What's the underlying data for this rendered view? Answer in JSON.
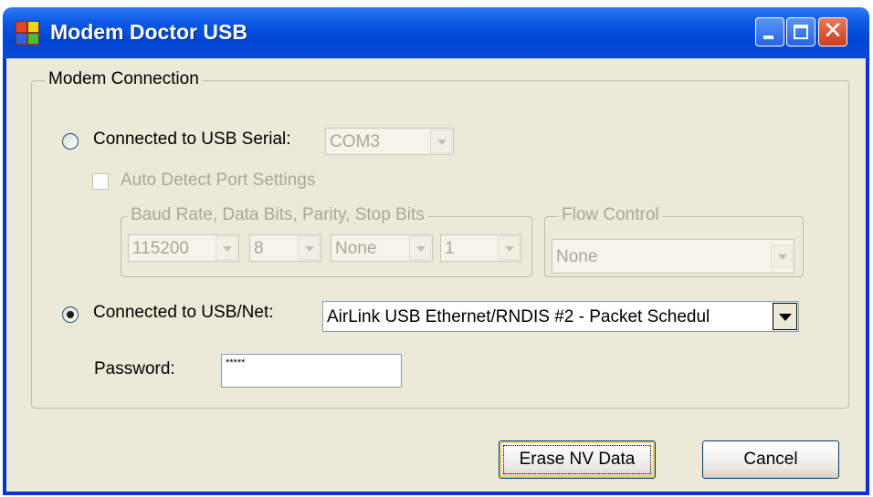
{
  "window": {
    "title": "Modem Doctor USB"
  },
  "modem_connection": {
    "group_label": "Modem Connection",
    "usb_serial": {
      "label": "Connected to USB Serial:",
      "selected": false,
      "port": "COM3",
      "auto_detect_label": "Auto Detect Port Settings",
      "auto_detect_checked": false,
      "port_settings_label": "Baud Rate, Data Bits, Parity, Stop Bits",
      "baud_rate": "115200",
      "data_bits": "8",
      "parity": "None",
      "stop_bits": "1",
      "flow_control_label": "Flow Control",
      "flow_control": "None"
    },
    "usb_net": {
      "label": "Connected to USB/Net:",
      "selected": true,
      "adapter": "AirLink USB Ethernet/RNDIS #2 - Packet Schedul"
    },
    "password": {
      "label": "Password:",
      "value": "*****"
    }
  },
  "buttons": {
    "erase": "Erase NV Data",
    "cancel": "Cancel"
  },
  "colors": {
    "title_bar": "#0a58e4",
    "window_face": "#ece9d8",
    "close_button": "#c8401f",
    "disabled_text": "#a9a797"
  },
  "icons": {
    "app": "app-icon",
    "minimize": "minimize-icon",
    "maximize": "maximize-icon",
    "close": "close-icon"
  }
}
